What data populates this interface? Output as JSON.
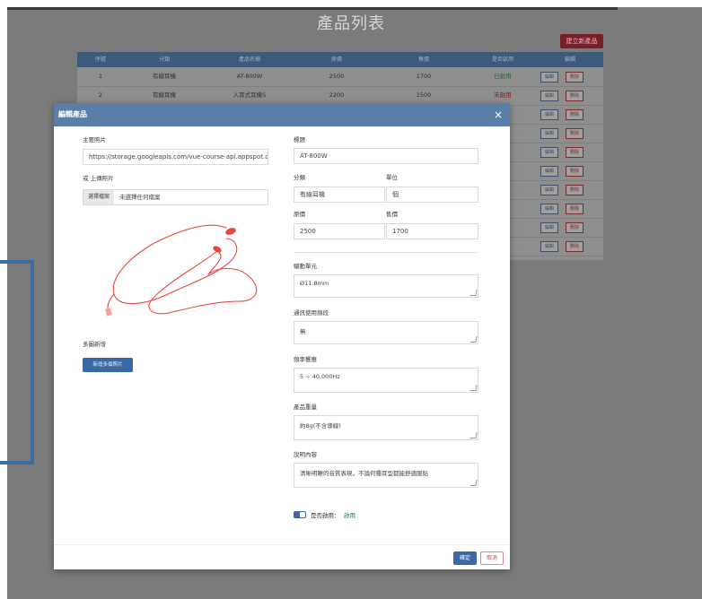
{
  "page": {
    "title": "產品列表",
    "create_label": "建立新產品"
  },
  "table": {
    "headers": [
      "序號",
      "分類",
      "產品名稱",
      "原價",
      "售價",
      "是否啟用",
      "編輯"
    ],
    "rows": [
      {
        "index": "1",
        "category": "有線耳機",
        "name": "AT-800W",
        "origin_price": "2500",
        "price": "1700",
        "status": "已啟用"
      },
      {
        "index": "2",
        "category": "有線耳機",
        "name": "入耳式耳機S",
        "origin_price": "2200",
        "price": "1500",
        "status": "未啟用"
      }
    ],
    "edit_label": "編輯",
    "delete_label": "刪除"
  },
  "modal": {
    "title": "編輯產品",
    "close_glyph": "×",
    "main_image_label": "主要照片",
    "main_image_value": "https://storage.googleapis.com/vue-course-api.appspot.c",
    "upload_label": "或 上傳照片",
    "file_button": "選擇檔案",
    "file_status": "未選擇任何檔案",
    "multi_image_label": "多圖新增",
    "multi_image_button": "新增多個照片",
    "title_label": "標題",
    "title_value": "AT-800W",
    "category_label": "分類",
    "category_value": "有線耳機",
    "unit_label": "單位",
    "unit_value": "個",
    "origin_price_label": "原價",
    "origin_price_value": "2500",
    "price_label": "售價",
    "price_value": "1700",
    "driver_label": "驅動單元",
    "driver_value": "Ø11.8mm",
    "mic_label": "通訊使用頻段",
    "mic_value": "無",
    "freq_label": "頻率響應",
    "freq_value": "5 ~ 40,000Hz",
    "weight_label": "產品重量",
    "weight_value": "約8g(不含導線)",
    "desc_label": "說明內容",
    "desc_value": "清晰明瞭的音質表現，不論何種耳型都能舒適服貼",
    "enabled_label": "是否啟用：",
    "enabled_state": "啟用",
    "ok_label": "確定",
    "cancel_label": "取消"
  },
  "colors": {
    "header_blue": "#5a7ea8",
    "primary": "#3b69a5",
    "danger": "#c34b4b",
    "success": "#2d7d4d",
    "cable_red": "#e8473e"
  }
}
